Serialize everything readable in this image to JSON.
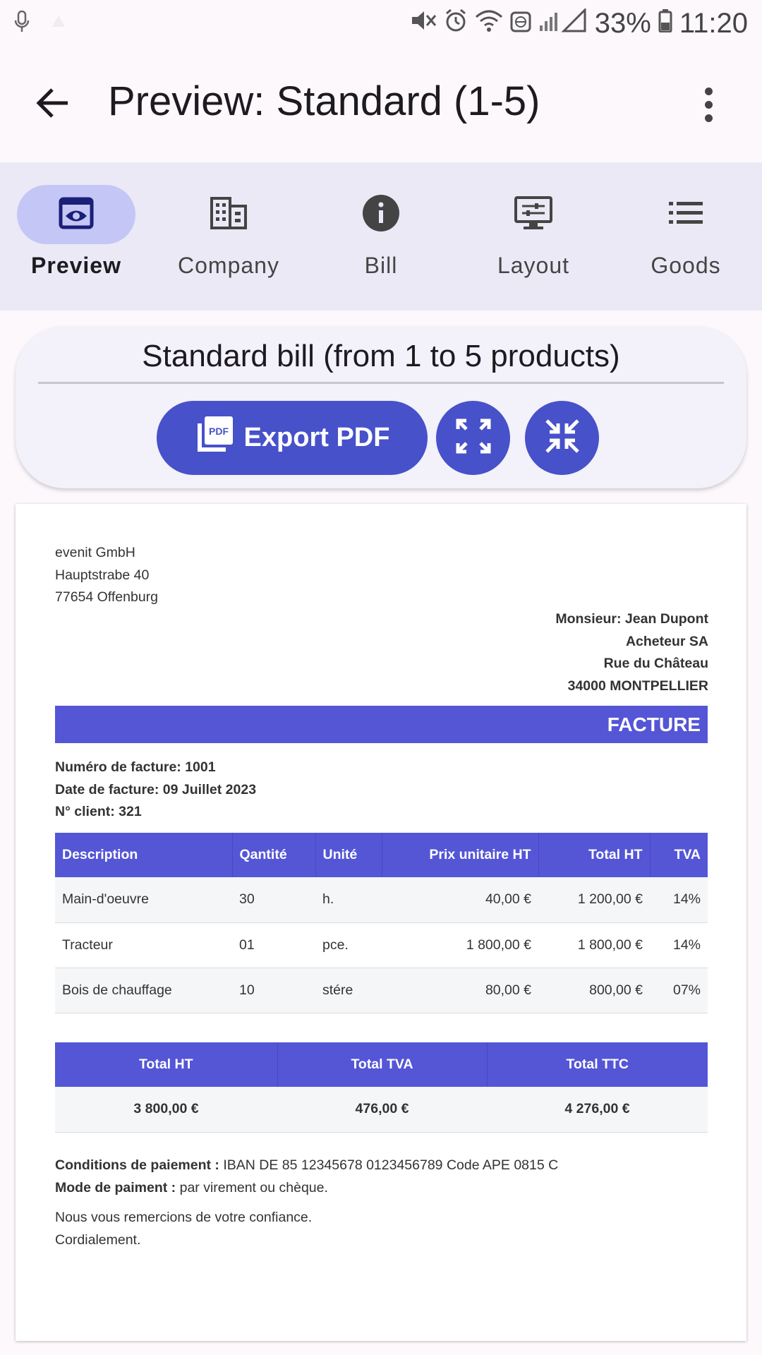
{
  "status_bar": {
    "battery": "33%",
    "time": "11:20"
  },
  "app_bar": {
    "title": "Preview: Standard (1-5)"
  },
  "tabs": [
    {
      "label": "Preview",
      "icon": "eye-icon",
      "active": true
    },
    {
      "label": "Company",
      "icon": "building-icon",
      "active": false
    },
    {
      "label": "Bill",
      "icon": "info-icon",
      "active": false
    },
    {
      "label": "Layout",
      "icon": "layout-icon",
      "active": false
    },
    {
      "label": "Goods",
      "icon": "list-icon",
      "active": false
    }
  ],
  "header": {
    "bill_type": "Standard bill (from 1 to 5 products)",
    "export_label": "Export PDF"
  },
  "colors": {
    "accent": "#4751c9",
    "invoice_blue": "#5456d6",
    "tab_bar_bg": "#ebe9f6",
    "active_tab_pill": "#c4c7f5"
  },
  "document": {
    "sender": {
      "name": "evenit GmbH",
      "street": "Hauptstrabe 40",
      "city": "77654 Offenburg"
    },
    "recipient": {
      "name": "Monsieur: Jean Dupont",
      "company": "Acheteur SA",
      "street": "Rue du Château",
      "city": "34000 MONTPELLIER"
    },
    "title": "FACTURE",
    "meta": {
      "invoice_number": "Numéro de facture: 1001",
      "invoice_date": "Date de facture: 09 Juillet 2023",
      "client_number": "N° client: 321"
    },
    "items": {
      "headers": [
        "Description",
        "Qantité",
        "Unité",
        "Prix unitaire HT",
        "Total HT",
        "TVA"
      ],
      "rows": [
        [
          "Main-d'oeuvre",
          "30",
          "h.",
          "40,00 €",
          "1 200,00 €",
          "14%"
        ],
        [
          "Tracteur",
          "01",
          "pce.",
          "1 800,00 €",
          "1 800,00 €",
          "14%"
        ],
        [
          "Bois de chauffage",
          "10",
          "stére",
          "80,00 €",
          "800,00 €",
          "07%"
        ]
      ]
    },
    "totals": {
      "headers": [
        "Total HT",
        "Total TVA",
        "Total TTC"
      ],
      "values": [
        "3 800,00 €",
        "476,00 €",
        "4 276,00 €"
      ]
    },
    "payment": {
      "conditions_label": "Conditions de paiement :",
      "conditions_value": " IBAN DE 85 12345678 0123456789 Code APE 0815 C",
      "mode_label": "Mode de paiment :",
      "mode_value": " par virement ou chèque."
    },
    "closing": {
      "thanks": "Nous vous remercions de votre confiance.",
      "regards": "Cordialement."
    }
  }
}
